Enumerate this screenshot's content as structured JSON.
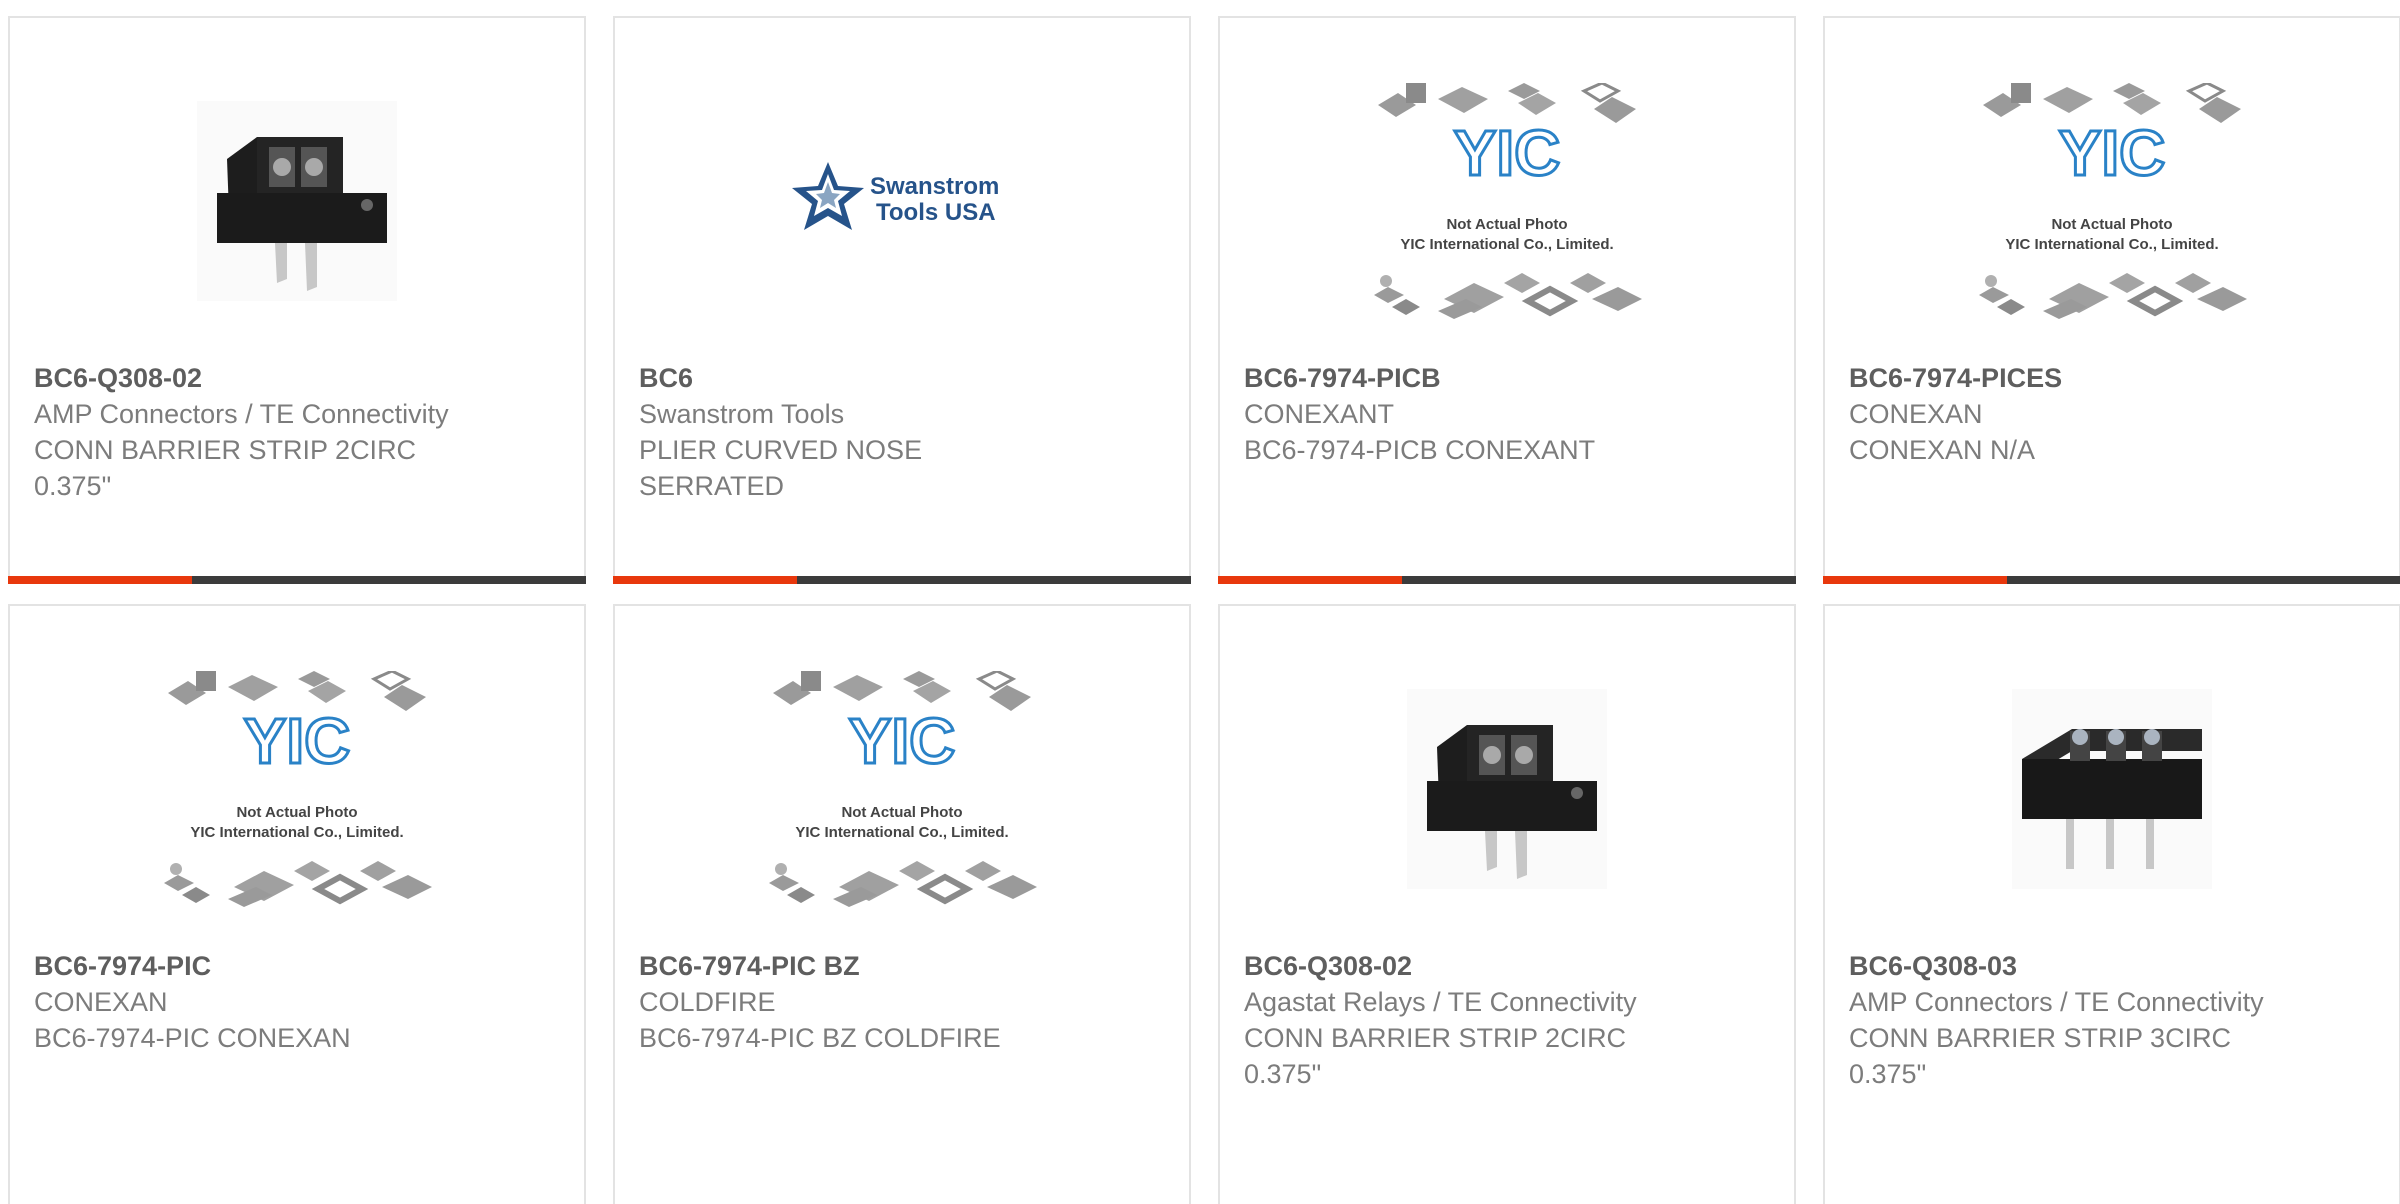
{
  "colors": {
    "accent": "#e8380d",
    "bar": "#3b3b3b",
    "border": "#e3e3e3",
    "title": "#5e5e5e",
    "text": "#7c7c7c"
  },
  "products": [
    {
      "part": "BC6-Q308-02",
      "manufacturer": "AMP Connectors / TE Connectivity",
      "description": "CONN BARRIER STRIP 2CIRC 0.375\"",
      "image": "barrier-strip-2-icon"
    },
    {
      "part": "BC6",
      "manufacturer": "Swanstrom Tools",
      "description": "PLIER CURVED NOSE SERRATED",
      "image": "swanstrom-logo",
      "logo_text": [
        "Swanstrom",
        "Tools USA"
      ]
    },
    {
      "part": "BC6-7974-PICB",
      "manufacturer": "CONEXANT",
      "description": "BC6-7974-PICB CONEXANT",
      "image": "yic-placeholder"
    },
    {
      "part": "BC6-7974-PICES",
      "manufacturer": "CONEXAN",
      "description": "CONEXAN N/A",
      "image": "yic-placeholder"
    },
    {
      "part": "BC6-7974-PIC",
      "manufacturer": "CONEXAN",
      "description": "BC6-7974-PIC CONEXAN",
      "image": "yic-placeholder"
    },
    {
      "part": "BC6-7974-PIC BZ",
      "manufacturer": "COLDFIRE",
      "description": "BC6-7974-PIC BZ COLDFIRE",
      "image": "yic-placeholder"
    },
    {
      "part": "BC6-Q308-02",
      "manufacturer": "Agastat Relays / TE Connectivity",
      "description": "CONN BARRIER STRIP 2CIRC 0.375\"",
      "image": "barrier-strip-2-icon"
    },
    {
      "part": "BC6-Q308-03",
      "manufacturer": "AMP Connectors / TE Connectivity",
      "description": "CONN BARRIER STRIP 3CIRC 0.375\"",
      "image": "barrier-strip-3-icon"
    }
  ],
  "yic": {
    "logo": "YIC",
    "line1": "Not Actual Photo",
    "line2": "YIC International Co., Limited."
  }
}
